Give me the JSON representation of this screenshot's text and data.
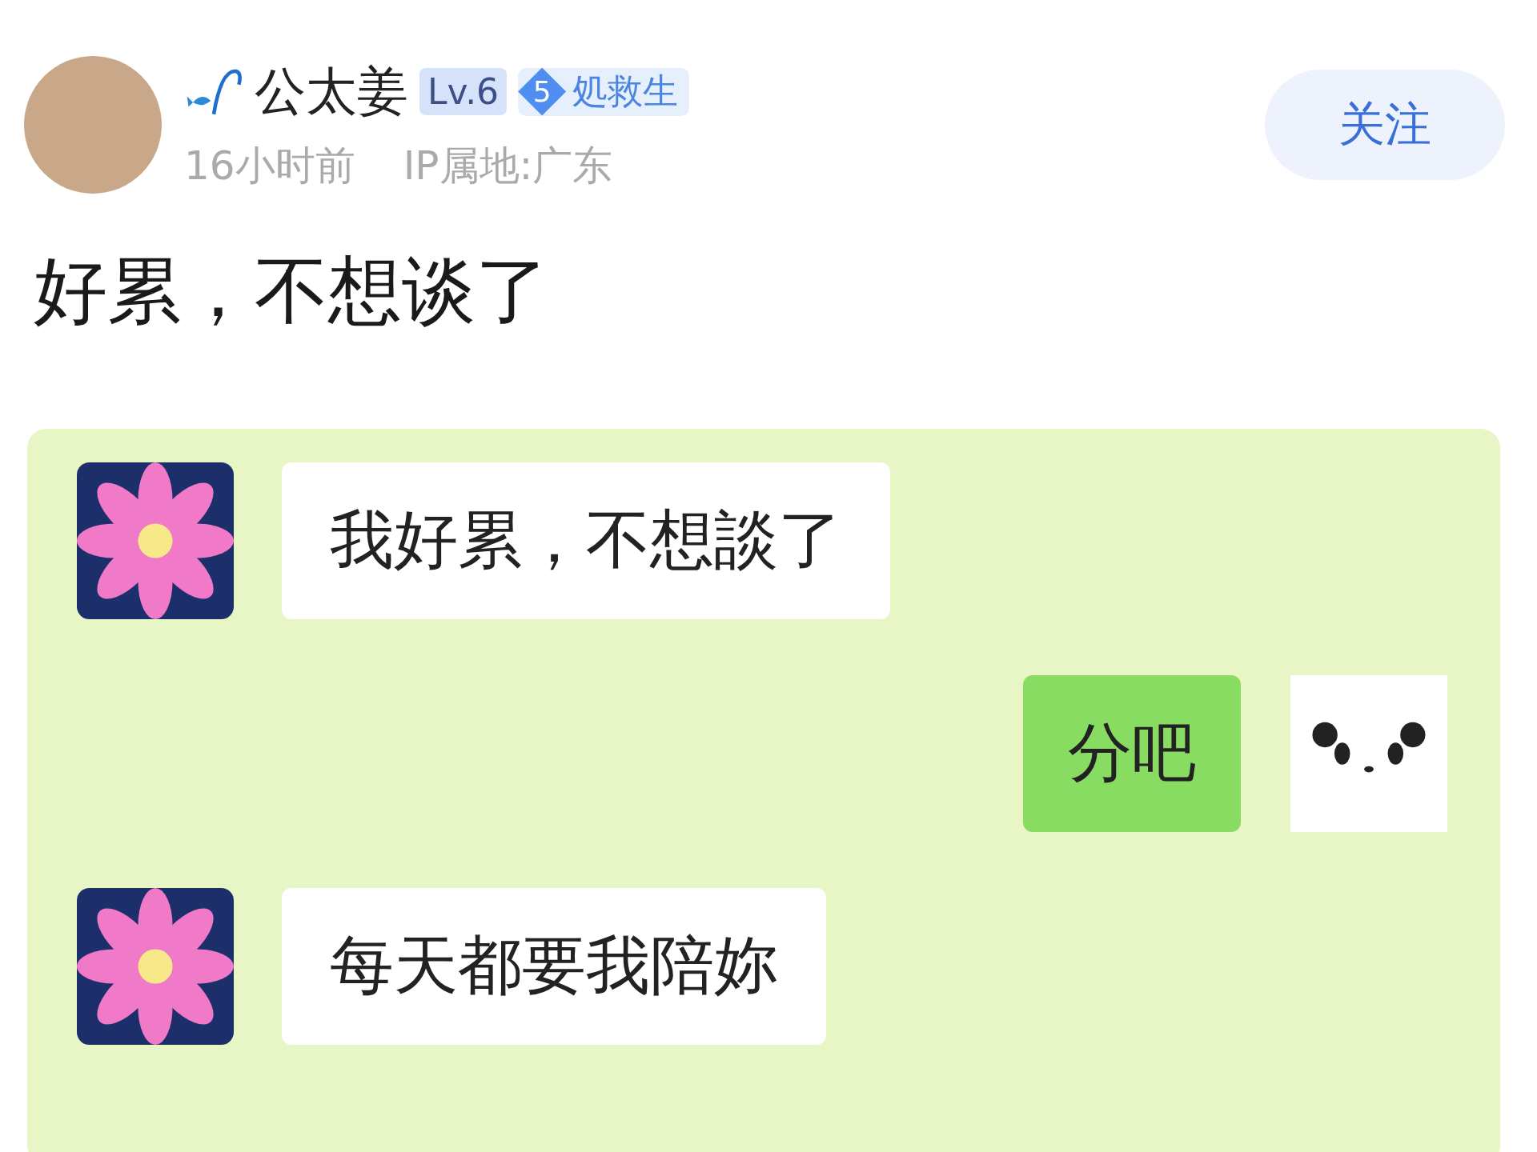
{
  "post": {
    "author": "公太姜",
    "level_badge": "Lv.6",
    "medal": {
      "number": "5",
      "label": "処救生"
    },
    "time": "16小时前",
    "ip_location": "IP属地:广东",
    "follow_button": "关注",
    "text": "好累，不想谈了"
  },
  "chat": {
    "messages": [
      {
        "kind": "received",
        "text": "我好累，不想談了"
      },
      {
        "kind": "sent",
        "text": "分吧"
      },
      {
        "kind": "received",
        "text": "每天都要我陪妳"
      }
    ]
  }
}
